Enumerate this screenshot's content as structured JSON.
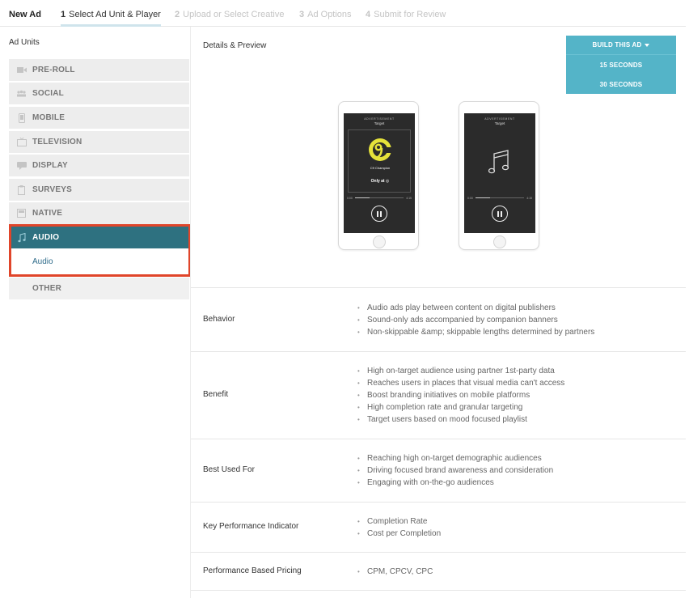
{
  "wizard": {
    "title": "New Ad",
    "steps": [
      {
        "num": "1",
        "label": "Select Ad Unit & Player"
      },
      {
        "num": "2",
        "label": "Upload or Select Creative"
      },
      {
        "num": "3",
        "label": "Ad Options"
      },
      {
        "num": "4",
        "label": "Submit for Review"
      }
    ],
    "active_step": 1
  },
  "sidebar": {
    "heading": "Ad Units",
    "units": [
      {
        "label": "PRE-ROLL",
        "icon": "video-camera-icon"
      },
      {
        "label": "SOCIAL",
        "icon": "people-icon"
      },
      {
        "label": "MOBILE",
        "icon": "mobile-phone-icon"
      },
      {
        "label": "TELEVISION",
        "icon": "television-icon"
      },
      {
        "label": "DISPLAY",
        "icon": "display-chat-icon"
      },
      {
        "label": "SURVEYS",
        "icon": "clipboard-icon"
      },
      {
        "label": "NATIVE",
        "icon": "native-card-icon"
      },
      {
        "label": "AUDIO",
        "icon": "music-note-icon"
      },
      {
        "label": "OTHER",
        "icon": ""
      }
    ],
    "active_unit": "AUDIO",
    "sub_item": "Audio",
    "highlight_color": "#e0452a"
  },
  "preview": {
    "label": "Details & Preview",
    "build_menu": {
      "label": "BUILD THIS AD",
      "options": [
        "15 SECONDS",
        "30 SECONDS"
      ]
    },
    "phones": [
      {
        "advertisement": "ADVERTISEMENT",
        "brand": "Target",
        "logo_text": "C9 Champion",
        "only_at": "Only at",
        "time_start": "0:00",
        "time_end": "4:15",
        "progress": 0.3
      },
      {
        "advertisement": "ADVERTISEMENT",
        "brand": "Target",
        "time_start": "0:00",
        "time_end": "4:15",
        "progress": 0.3
      }
    ]
  },
  "details": [
    {
      "label": "Behavior",
      "items": [
        "Audio ads play between content on digital publishers",
        "Sound-only ads accompanied by companion banners",
        "Non-skippable &amp; skippable lengths determined by partners"
      ]
    },
    {
      "label": "Benefit",
      "items": [
        "High on-target audience using partner 1st-party data",
        "Reaches users in places that visual media can't access",
        "Boost branding initiatives on mobile platforms",
        "High completion rate and granular targeting",
        "Target users based on mood focused playlist"
      ]
    },
    {
      "label": "Best Used For",
      "items": [
        "Reaching high on-target demographic audiences",
        "Driving focused brand awareness and consideration",
        "Engaging with on-the-go audiences"
      ]
    },
    {
      "label": "Key Performance Indicator",
      "items": [
        "Completion Rate",
        "Cost per Completion"
      ]
    },
    {
      "label": "Performance Based Pricing",
      "items": [
        "CPM, CPCV, CPC"
      ]
    }
  ],
  "colors": {
    "accent_active": "#2e7180",
    "build_button": "#54b4c8",
    "highlight": "#e0452a"
  }
}
